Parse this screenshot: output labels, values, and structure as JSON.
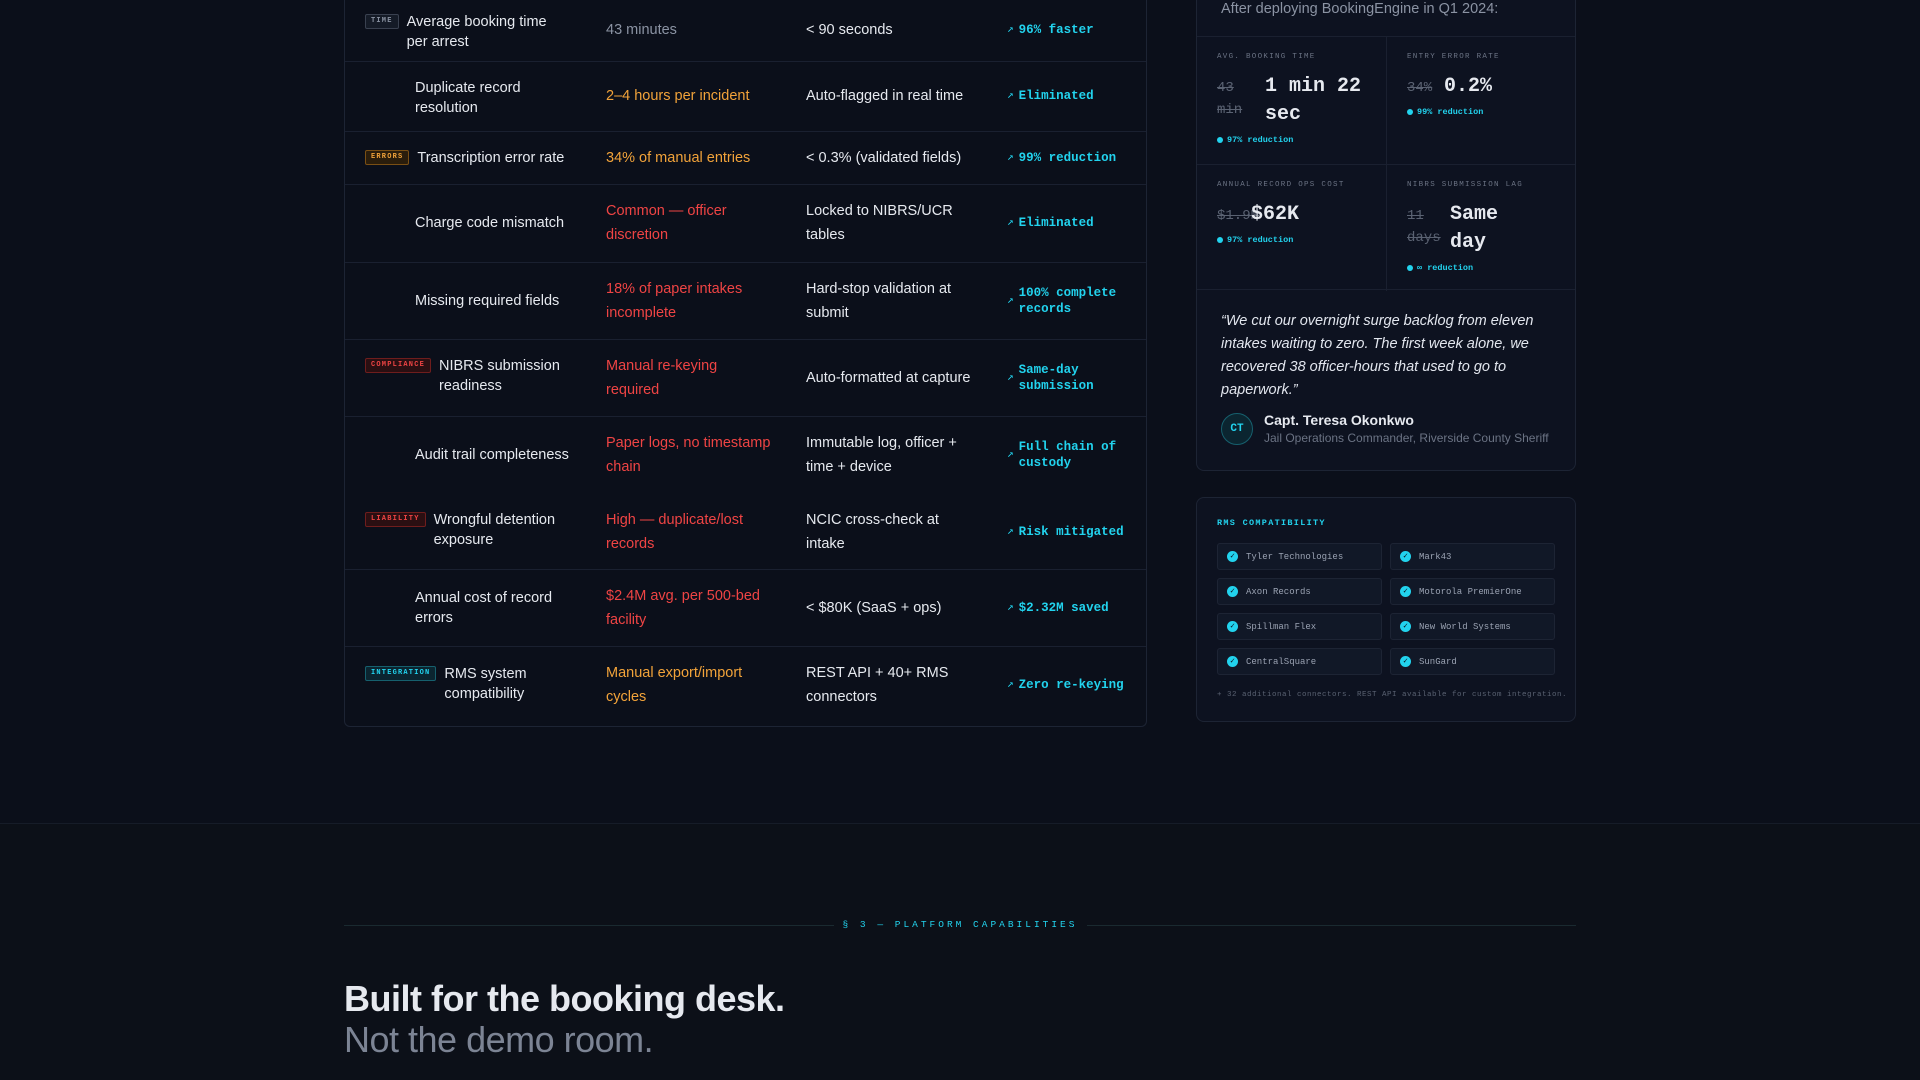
{
  "comparison": {
    "rows": [
      {
        "tag": "TIME",
        "metric": "Average booking time per arrest",
        "before": "43 minutes",
        "after": "< 90 seconds",
        "impact": "96% faster"
      },
      {
        "tag": "",
        "metric": "Duplicate record resolution",
        "before": "2–4 hours per incident",
        "after": "Auto-flagged in real time",
        "impact": "Eliminated"
      },
      {
        "tag": "ERRORS",
        "metric": "Transcription error rate",
        "before": "34% of manual entries",
        "after": "< 0.3% (validated fields)",
        "impact": "99% reduction"
      },
      {
        "tag": "",
        "metric": "Charge code mismatch",
        "before": "Common — officer discretion",
        "after": "Locked to NIBRS/UCR tables",
        "impact": "Eliminated"
      },
      {
        "tag": "",
        "metric": "Missing required fields",
        "before": "18% of paper intakes incomplete",
        "after": "Hard-stop validation at submit",
        "impact": "100% complete records"
      },
      {
        "tag": "COMPLIANCE",
        "metric": "NIBRS submission readiness",
        "before": "Manual re-keying required",
        "after": "Auto-formatted at capture",
        "impact": "Same-day submission"
      },
      {
        "tag": "",
        "metric": "Audit trail completeness",
        "before": "Paper logs, no timestamp chain",
        "after": "Immutable log, officer + time + device",
        "impact": "Full chain of custody"
      },
      {
        "tag": "LIABILITY",
        "metric": "Wrongful detention exposure",
        "before": "High — duplicate/lost records",
        "after": "NCIC cross-check at intake",
        "impact": "Risk mitigated"
      },
      {
        "tag": "",
        "metric": "Annual cost of record errors",
        "before": "$2.4M avg. per 500-bed facility",
        "after": "< $80K (SaaS + ops)",
        "impact": "$2.32M saved"
      },
      {
        "tag": "INTEGRATION",
        "metric": "RMS system compatibility",
        "before": "Manual export/import cycles",
        "after": "REST API + 40+ RMS connectors",
        "impact": "Zero re-keying"
      }
    ]
  },
  "results": {
    "intro": "After deploying BookingEngine in Q1 2024:",
    "stats": [
      {
        "label": "AVG. BOOKING TIME",
        "old": "43 min",
        "new": "1 min 22 sec",
        "delta": "97% reduction"
      },
      {
        "label": "ENTRY ERROR RATE",
        "old": "34%",
        "new": "0.2%",
        "delta": "99% reduction"
      },
      {
        "label": "ANNUAL RECORD OPS COST",
        "old": "$1.9M",
        "new": "$62K",
        "delta": "97% reduction"
      },
      {
        "label": "NIBRS SUBMISSION LAG",
        "old": "11 days",
        "new": "Same day",
        "delta": "∞ reduction"
      }
    ],
    "quote": "“We cut our overnight surge backlog from eleven intakes waiting to zero. The first week alone, we recovered 38 officer-hours that used to go to paperwork.”",
    "author": {
      "initials": "CT",
      "name": "Capt. Teresa Okonkwo",
      "role": "Jail Operations Commander, Riverside County Sheriff"
    }
  },
  "rms": {
    "title": "RMS COMPATIBILITY",
    "items": [
      "Tyler Technologies",
      "Mark43",
      "Axon Records",
      "Motorola PremierOne",
      "Spillman Flex",
      "New World Systems",
      "CentralSquare",
      "SunGard"
    ],
    "footnote": "+ 32 additional connectors. REST API available for custom integration."
  },
  "section": {
    "label": "§ 3 — PLATFORM CAPABILITIES",
    "headline": "Built for the booking desk.",
    "subhead": "Not the demo room."
  },
  "colors": {
    "accent": "#22d3ee",
    "warning": "#f2a33a",
    "danger": "#ef4444",
    "background": "#0b0f1a"
  },
  "icons": {
    "impact": "trend-up-icon",
    "rms_item": "check-circle-icon"
  }
}
